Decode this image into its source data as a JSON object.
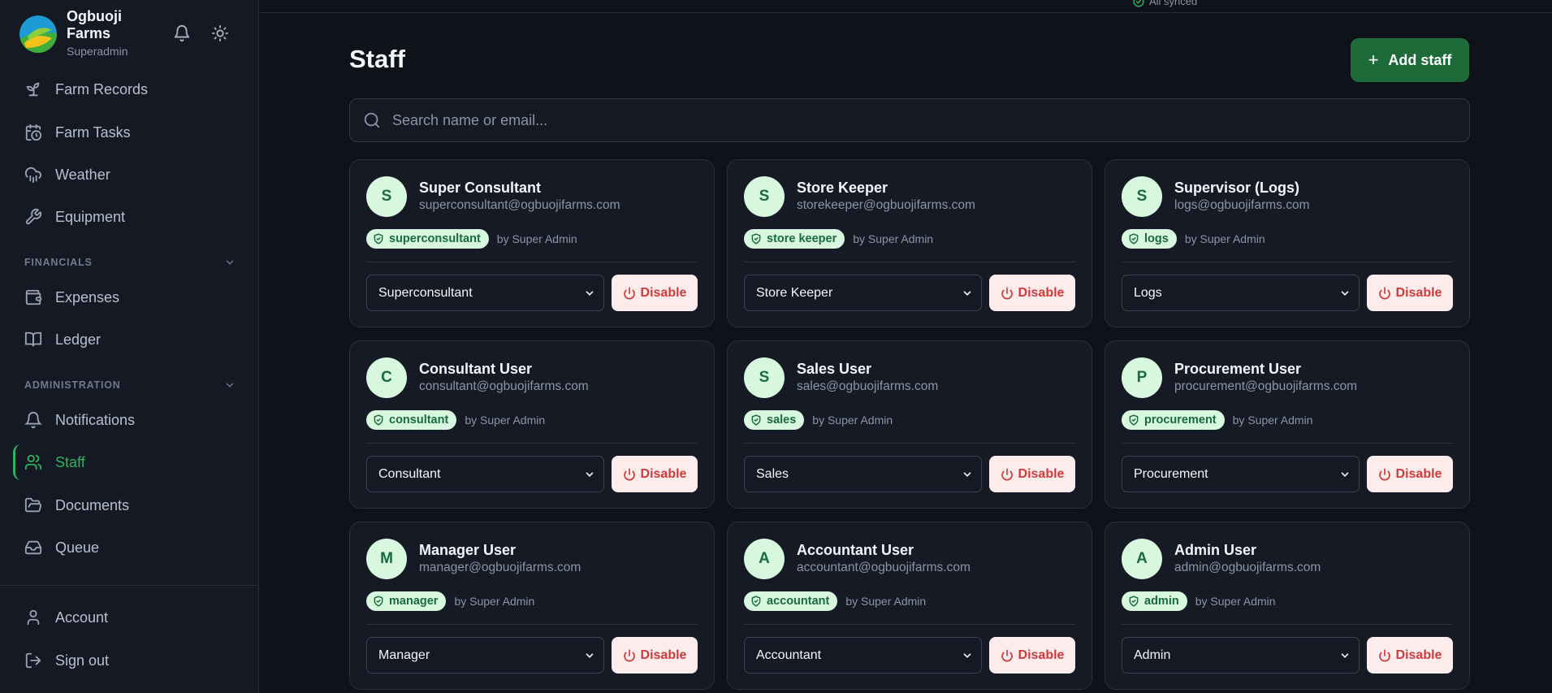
{
  "brand": {
    "name": "Ogbuoji Farms",
    "role": "Superadmin"
  },
  "nav": {
    "farm_records": "Farm Records",
    "farm_tasks": "Farm Tasks",
    "weather": "Weather",
    "equipment": "Equipment",
    "financials_label": "FINANCIALS",
    "expenses": "Expenses",
    "ledger": "Ledger",
    "administration_label": "ADMINISTRATION",
    "notifications": "Notifications",
    "staff": "Staff",
    "documents": "Documents",
    "queue": "Queue",
    "account": "Account",
    "sign_out": "Sign out",
    "active": "staff"
  },
  "topbar": {
    "sync_status": "All synced"
  },
  "page": {
    "title": "Staff",
    "add_label": "Add staff"
  },
  "search": {
    "placeholder": "Search name or email..."
  },
  "colors": {
    "accent": "#1e6b3a",
    "active_nav": "#2fb261",
    "danger": "#d13a3a",
    "badge_bg": "#d7f7df"
  },
  "staff": [
    {
      "initial": "S",
      "name": "Super Consultant",
      "email": "superconsultant@ogbuojifarms.com",
      "badge": "superconsultant",
      "by": "by Super Admin",
      "role": "Superconsultant",
      "disable_label": "Disable"
    },
    {
      "initial": "S",
      "name": "Store Keeper",
      "email": "storekeeper@ogbuojifarms.com",
      "badge": "store keeper",
      "by": "by Super Admin",
      "role": "Store Keeper",
      "disable_label": "Disable"
    },
    {
      "initial": "S",
      "name": "Supervisor (Logs)",
      "email": "logs@ogbuojifarms.com",
      "badge": "logs",
      "by": "by Super Admin",
      "role": "Logs",
      "disable_label": "Disable"
    },
    {
      "initial": "C",
      "name": "Consultant User",
      "email": "consultant@ogbuojifarms.com",
      "badge": "consultant",
      "by": "by Super Admin",
      "role": "Consultant",
      "disable_label": "Disable"
    },
    {
      "initial": "S",
      "name": "Sales User",
      "email": "sales@ogbuojifarms.com",
      "badge": "sales",
      "by": "by Super Admin",
      "role": "Sales",
      "disable_label": "Disable"
    },
    {
      "initial": "P",
      "name": "Procurement User",
      "email": "procurement@ogbuojifarms.com",
      "badge": "procurement",
      "by": "by Super Admin",
      "role": "Procurement",
      "disable_label": "Disable"
    },
    {
      "initial": "M",
      "name": "Manager User",
      "email": "manager@ogbuojifarms.com",
      "badge": "manager",
      "by": "by Super Admin",
      "role": "Manager",
      "disable_label": "Disable"
    },
    {
      "initial": "A",
      "name": "Accountant User",
      "email": "accountant@ogbuojifarms.com",
      "badge": "accountant",
      "by": "by Super Admin",
      "role": "Accountant",
      "disable_label": "Disable"
    },
    {
      "initial": "A",
      "name": "Admin User",
      "email": "admin@ogbuojifarms.com",
      "badge": "admin",
      "by": "by Super Admin",
      "role": "Admin",
      "disable_label": "Disable"
    }
  ]
}
